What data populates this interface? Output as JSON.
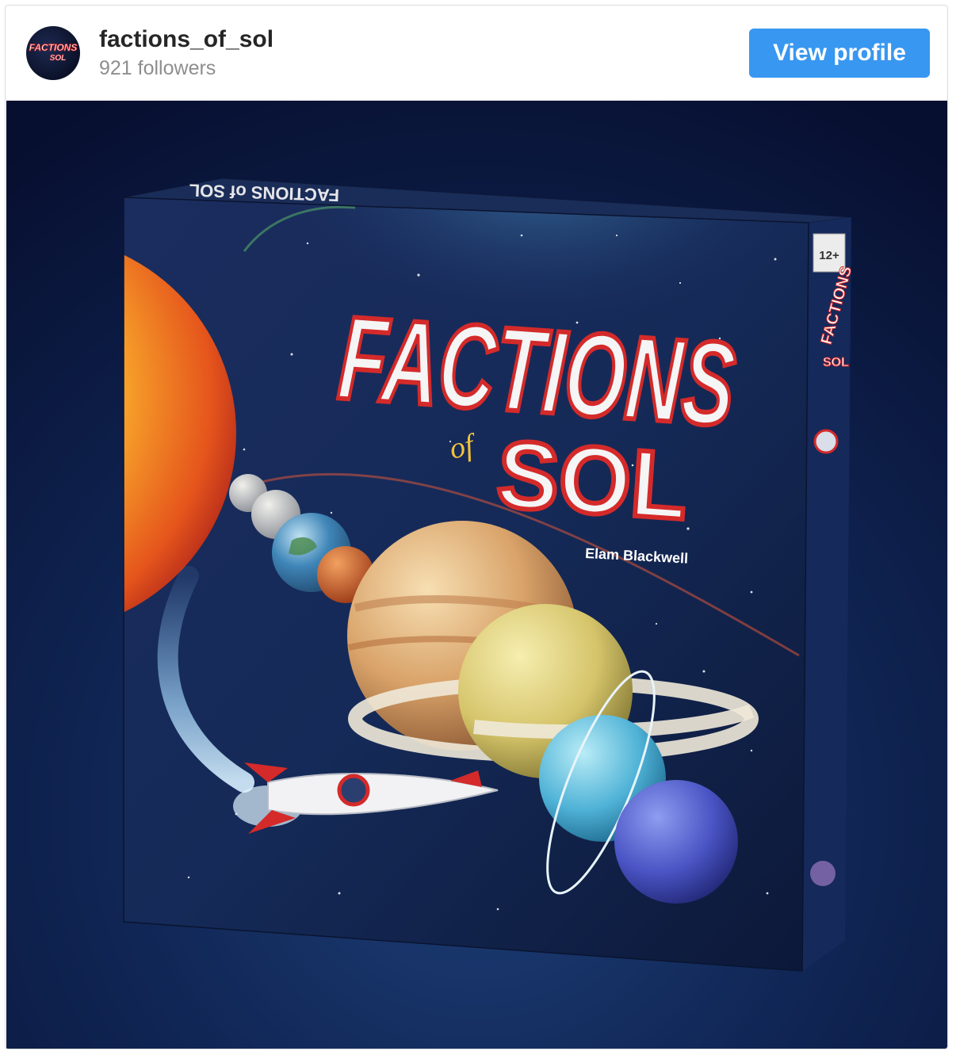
{
  "profile": {
    "username": "factions_of_sol",
    "followers_label": "921 followers",
    "avatar_logo_line1": "FACTIONS",
    "avatar_logo_line2": "SOL"
  },
  "actions": {
    "view_profile_label": "View profile",
    "accent_color": "#3897f0"
  },
  "post_image": {
    "box_title_main": "FACTIONS",
    "box_title_of": "of",
    "box_title_sol": "SOL",
    "box_author": "Elam Blackwell",
    "box_side_title": "FACTIONS",
    "box_side_sol": "SOL",
    "box_side_age": "12+",
    "box_top_text": "FACTIONS of SOL"
  }
}
